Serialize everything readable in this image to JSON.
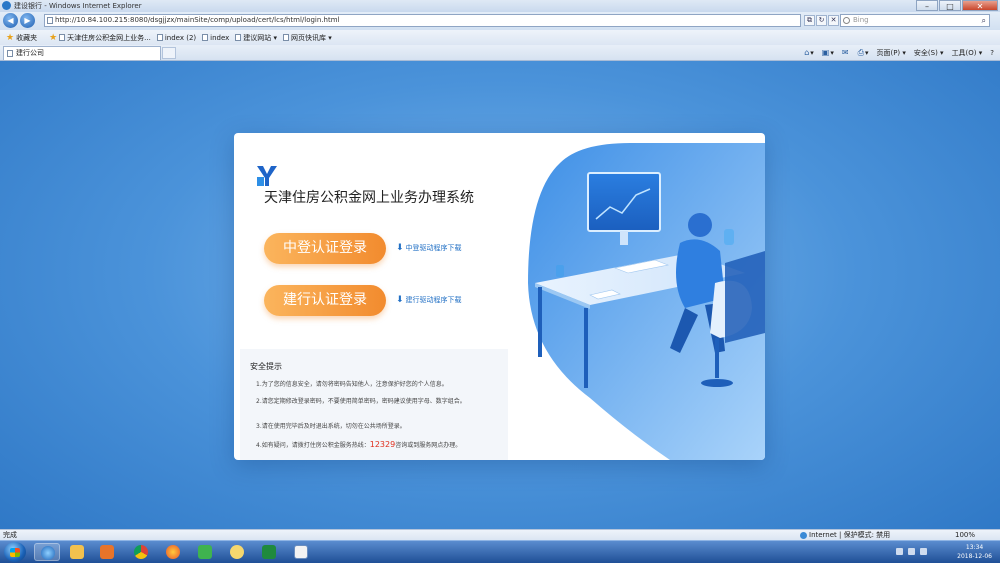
{
  "window": {
    "title": "建设银行 - Windows Internet Explorer",
    "buttons": {
      "minimize": "–",
      "maximize": "□",
      "close": "✕"
    }
  },
  "address_bar": {
    "url": "http://10.84.100.215:8080/dsgjjzx/mainSite/comp/upload/cert/lcs/html/login.html",
    "search_placeholder": "Bing"
  },
  "favorites_bar": {
    "favorites_label": "收藏夹",
    "items": [
      "天津住房公积金网上业务...",
      "index (2)",
      "index",
      "建议网站 ▾",
      "网页快讯库 ▾"
    ]
  },
  "tabs": [
    {
      "label": "建行公司"
    }
  ],
  "command_bar": [
    "页面(P) ▾",
    "安全(S) ▾",
    "工具(O) ▾",
    "?"
  ],
  "page": {
    "system_title": "天津住房公积金网上业务办理系统",
    "login_buttons": [
      {
        "label": "中登认证登录",
        "download": "中登驱动程序下载"
      },
      {
        "label": "建行认证登录",
        "download": "建行驱动程序下载"
      }
    ],
    "notice": {
      "title": "安全提示",
      "paragraphs": [
        "1.为了您的信息安全，请勿将密码告知他人，注意保护好您的个人信息。",
        "2.请您定期修改登录密码，不要使用简单密码，密码建议使用字母、数字组合。",
        "3.请在使用完毕后及时退出系统，切勿在公共场所登录。"
      ],
      "hotline_prefix": "4.如有疑问，请拨打住房公积金服务热线：",
      "hotline": "12329",
      "hotline_suffix": "咨询或到服务网点办理。"
    }
  },
  "status_bar": {
    "left": "完成",
    "zone": "Internet | 保护模式: 禁用",
    "zoom": "100%"
  },
  "taskbar": {
    "clock_time": "13:34",
    "clock_date": "2018-12-06"
  },
  "colors": {
    "accent_orange": "#f28b2e",
    "link_blue": "#2270c5",
    "hotline_red": "#e0301e",
    "page_blue": "#4b93da"
  }
}
